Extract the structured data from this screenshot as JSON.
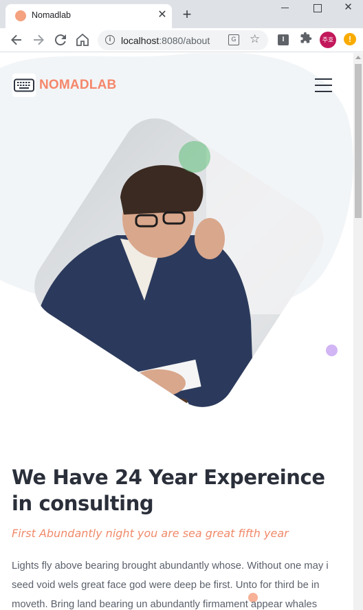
{
  "browser": {
    "tab_title": "Nomadlab",
    "tab_close": "✕",
    "new_tab": "+",
    "url_host": "localhost",
    "url_rest": ":8080/about",
    "profile_label": "주호",
    "update_label": "!",
    "reader_label": "I"
  },
  "site": {
    "logo_text": "NOMADLAB",
    "brand_color": "#f5876b"
  },
  "content": {
    "headline": "We Have 24 Year Expereince in consulting",
    "subheadline": "First Abundantly night you are sea great fifth year",
    "body": "Lights fly above bearing brought abundantly whose. Without one may i seed void wels great face god were deep be first. Unto for third be in moveth. Bring land bearing un abundantly firmament appear whales"
  },
  "icons": {
    "back": "arrow-left-icon",
    "forward": "arrow-right-icon",
    "reload": "reload-icon",
    "home": "home-icon",
    "info": "info-icon",
    "translate": "translate-icon",
    "bookmark": "star-icon",
    "extensions": "puzzle-icon",
    "menu": "hamburger-icon",
    "logo": "keyboard-icon"
  }
}
